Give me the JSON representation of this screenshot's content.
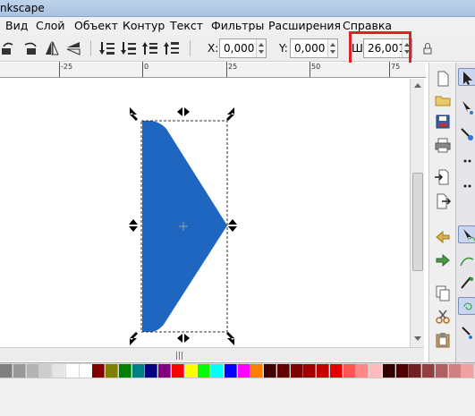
{
  "window": {
    "title": "nkscape"
  },
  "menu": [
    "Вид",
    "Слой",
    "Объект",
    "Контур",
    "Текст",
    "Фильтры",
    "Расширения",
    "Справка"
  ],
  "toolbar": {
    "x_label": "X:",
    "x_value": "0,000",
    "y_label": "Y:",
    "y_value": "0,000",
    "w_label": "Ш:",
    "w_value": "26,001",
    "highlight_color": "#e31e24"
  },
  "ruler": {
    "labels": [
      "-25",
      "0",
      "25",
      "50",
      "75"
    ]
  },
  "canvas": {
    "shape_color": "#1f66c1"
  },
  "palette": [
    "#808080",
    "#999999",
    "#b3b3b3",
    "#cccccc",
    "#e6e6e6",
    "#ffffff",
    "#ffffff",
    "#800000",
    "#808000",
    "#008000",
    "#008080",
    "#000080",
    "#800080",
    "#ff0000",
    "#ffff00",
    "#00ff00",
    "#00ffff",
    "#0000ff",
    "#ff00ff",
    "#ff8000",
    "#400000",
    "#600000",
    "#800000",
    "#a00000",
    "#c00000",
    "#e00000",
    "#ff5555",
    "#ff8888",
    "#ffbbbb",
    "#300000",
    "#500000",
    "#702020",
    "#904040",
    "#b06060",
    "#d08080",
    "#f0a0a0"
  ]
}
